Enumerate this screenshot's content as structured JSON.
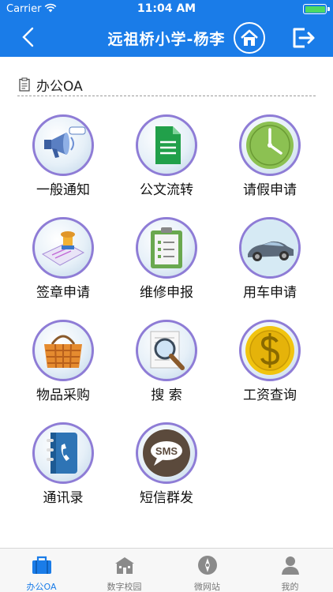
{
  "status_bar": {
    "carrier": "Carrier",
    "time": "11:04 AM",
    "battery_color": "#4cd964"
  },
  "nav": {
    "title": "远祖桥小学-杨李",
    "back_icon": "chevron-left-icon",
    "home_icon": "home-icon",
    "logout_icon": "logout-icon"
  },
  "section": {
    "title": "办公OA",
    "icon": "clipboard-icon"
  },
  "menu": [
    {
      "label": "一般通知",
      "icon": "megaphone-icon"
    },
    {
      "label": "公文流转",
      "icon": "document-icon"
    },
    {
      "label": "请假申请",
      "icon": "clock-icon"
    },
    {
      "label": "签章申请",
      "icon": "stamp-icon"
    },
    {
      "label": "维修申报",
      "icon": "clipboard-checklist-icon"
    },
    {
      "label": "用车申请",
      "icon": "car-icon"
    },
    {
      "label": "物品采购",
      "icon": "basket-icon"
    },
    {
      "label": "搜 索",
      "icon": "magnifier-icon"
    },
    {
      "label": "工资查询",
      "icon": "dollar-coin-icon"
    },
    {
      "label": "通讯录",
      "icon": "phone-book-icon"
    },
    {
      "label": "短信群发",
      "icon": "sms-icon"
    }
  ],
  "tabbar": {
    "tabs": [
      {
        "label": "办公OA",
        "icon": "briefcase-icon",
        "active": true
      },
      {
        "label": "数字校园",
        "icon": "school-icon",
        "active": false
      },
      {
        "label": "微网站",
        "icon": "compass-icon",
        "active": false
      },
      {
        "label": "我的",
        "icon": "user-icon",
        "active": false
      }
    ]
  },
  "colors": {
    "accent": "#1a7ce8",
    "circle_border": "#8e7cd6"
  }
}
